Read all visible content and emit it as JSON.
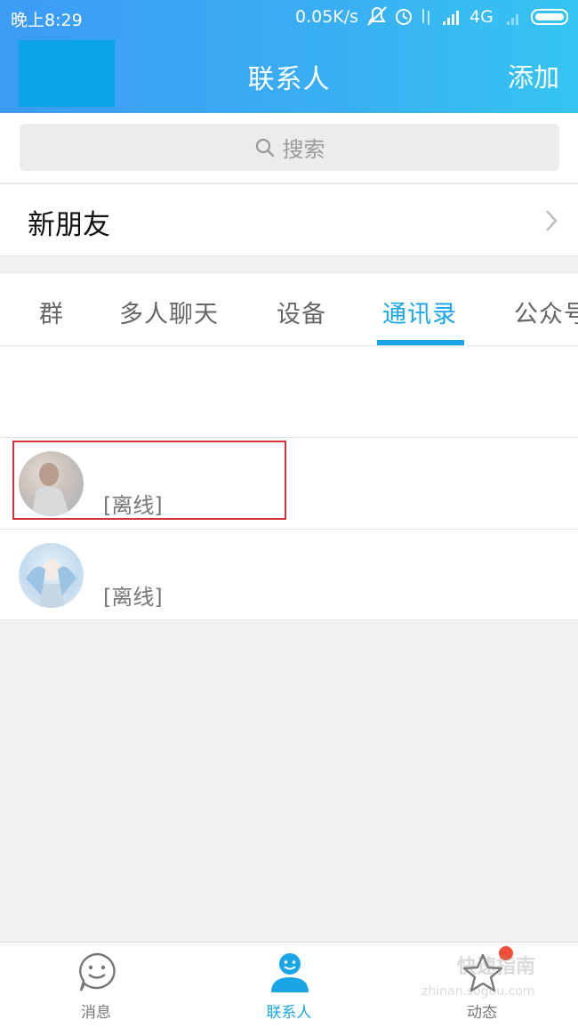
{
  "status_bar": {
    "time": "晚上8:29",
    "net_speed": "0.05K/s",
    "network": "4G"
  },
  "navbar": {
    "title": "联系人",
    "add_label": "添加"
  },
  "search": {
    "placeholder": "搜索"
  },
  "new_friends": {
    "label": "新朋友"
  },
  "tabs": [
    {
      "label": "群",
      "active": false
    },
    {
      "label": "多人聊天",
      "active": false
    },
    {
      "label": "设备",
      "active": false
    },
    {
      "label": "通讯录",
      "active": true
    },
    {
      "label": "公众号",
      "active": false
    }
  ],
  "contacts": [
    {
      "status": "[离线]"
    },
    {
      "status": "[离线]"
    }
  ],
  "bottom_nav": [
    {
      "label": "消息",
      "icon": "chat-smile-icon",
      "active": false
    },
    {
      "label": "联系人",
      "icon": "contact-person-icon",
      "active": true
    },
    {
      "label": "动态",
      "icon": "star-icon",
      "active": false
    }
  ],
  "watermark": {
    "text_cn": "快速指南",
    "text_en": "zhinan.sogou.com"
  },
  "colors": {
    "accent": "#1aa6e6",
    "header_gradient_start": "#3d9bf6",
    "header_gradient_end": "#35c4f1",
    "highlight_box": "#d6303a",
    "badge": "#f24f3a"
  }
}
